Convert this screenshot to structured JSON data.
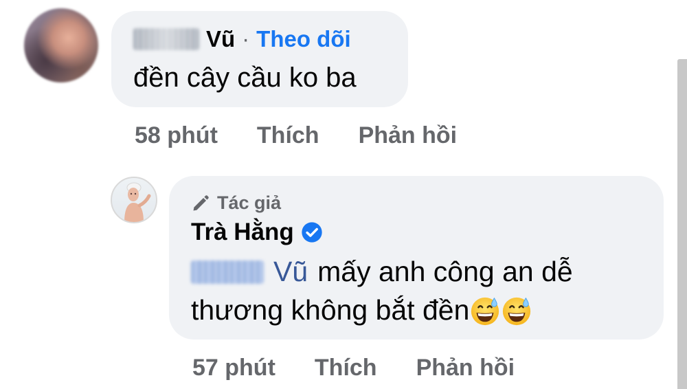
{
  "comment1": {
    "author_suffix": "Vũ",
    "separator": "·",
    "follow_label": "Theo dõi",
    "text": "đền cây cầu ko ba",
    "time": "58 phút",
    "like_label": "Thích",
    "reply_label": "Phản hồi"
  },
  "comment2": {
    "badge_label": "Tác giả",
    "author_name": "Trà Hằng",
    "mention_suffix": "Vũ",
    "text_line1": "mấy anh công an dễ",
    "text_line2": "thương không bắt đền",
    "emojis": [
      "grinning-face-with-sweat",
      "grinning-face-with-sweat"
    ],
    "time": "57 phút",
    "like_label": "Thích",
    "reply_label": "Phản hồi"
  },
  "colors": {
    "link_blue": "#1877f2",
    "mention_blue": "#385898",
    "secondary_text": "#65676b",
    "bubble_bg": "#f0f2f5",
    "verified_badge": "#1877f2"
  }
}
